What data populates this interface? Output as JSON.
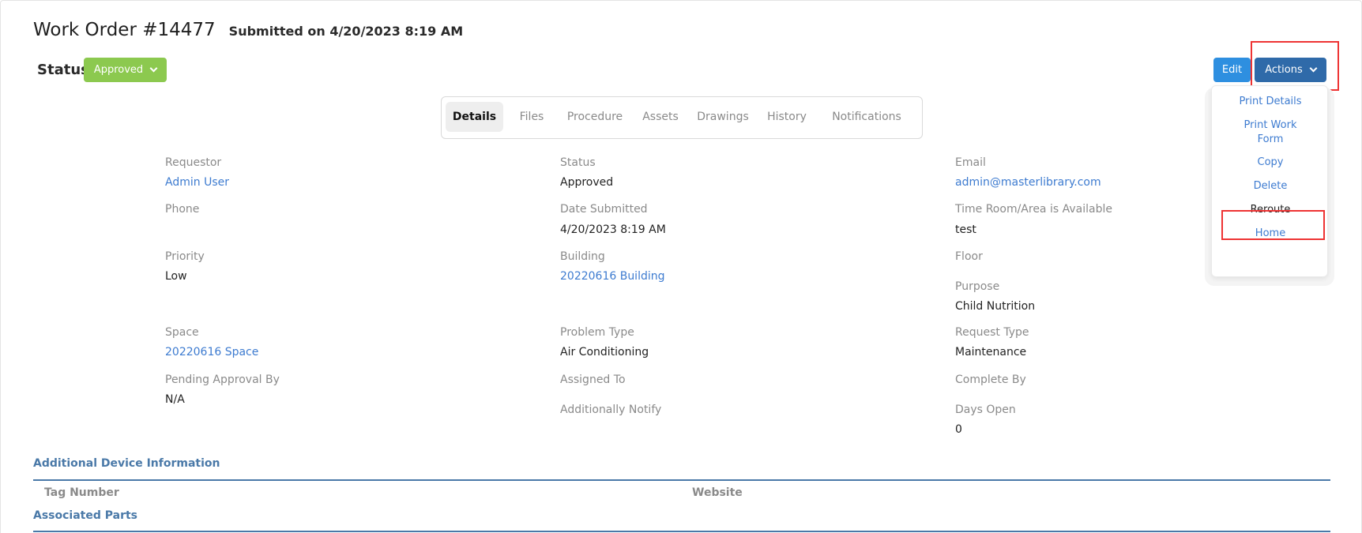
{
  "header": {
    "title": "Work Order #14477",
    "submitted": "Submitted on 4/20/2023 8:19 AM"
  },
  "status": {
    "label": "Status",
    "value": "Approved",
    "color": "#8cc94f"
  },
  "toolbar": {
    "edit_label": "Edit",
    "actions_label": "Actions"
  },
  "actions_menu": {
    "items": [
      "Print Details",
      "Print Work Form",
      "Copy",
      "Delete",
      "Reroute",
      "Home"
    ],
    "highlighted": "Reroute"
  },
  "tabs": [
    {
      "label": "Details",
      "active": true
    },
    {
      "label": "Files",
      "active": false
    },
    {
      "label": "Procedure",
      "active": false
    },
    {
      "label": "Assets",
      "active": false
    },
    {
      "label": "Drawings",
      "active": false
    },
    {
      "label": "History",
      "active": false
    },
    {
      "label": "Notifications",
      "active": false
    }
  ],
  "fields": {
    "requestor": {
      "label": "Requestor",
      "value": "Admin User"
    },
    "phone": {
      "label": "Phone",
      "value": ""
    },
    "priority": {
      "label": "Priority",
      "value": "Low"
    },
    "space": {
      "label": "Space",
      "value": "20220616 Space"
    },
    "pending_approval": {
      "label": "Pending Approval By",
      "value": "N/A"
    },
    "status": {
      "label": "Status",
      "value": "Approved"
    },
    "date_submitted": {
      "label": "Date Submitted",
      "value": "4/20/2023 8:19 AM"
    },
    "building": {
      "label": "Building",
      "value": "20220616 Building"
    },
    "problem_type": {
      "label": "Problem Type",
      "value": "Air Conditioning"
    },
    "assigned_to": {
      "label": "Assigned To",
      "value": ""
    },
    "additionally_notify": {
      "label": "Additionally Notify",
      "value": ""
    },
    "email": {
      "label": "Email",
      "value": "admin@masterlibrary.com"
    },
    "time_available": {
      "label": "Time Room/Area is Available",
      "value": "test"
    },
    "floor": {
      "label": "Floor",
      "value": ""
    },
    "purpose": {
      "label": "Purpose",
      "value": "Child Nutrition"
    },
    "request_type": {
      "label": "Request Type",
      "value": "Maintenance"
    },
    "complete_by": {
      "label": "Complete By",
      "value": ""
    },
    "days_open": {
      "label": "Days Open",
      "value": "0"
    }
  },
  "sections": {
    "device_info": {
      "title": "Additional Device Information",
      "columns": [
        "Tag Number",
        "Website"
      ]
    },
    "associated_parts": {
      "title": "Associated Parts"
    }
  },
  "colors": {
    "edit_button": "#2e8fe0",
    "actions_button": "#2f6aa9",
    "link": "#3d7bd0",
    "section_accent": "#4a79a8",
    "highlight_box": "#e33333"
  }
}
